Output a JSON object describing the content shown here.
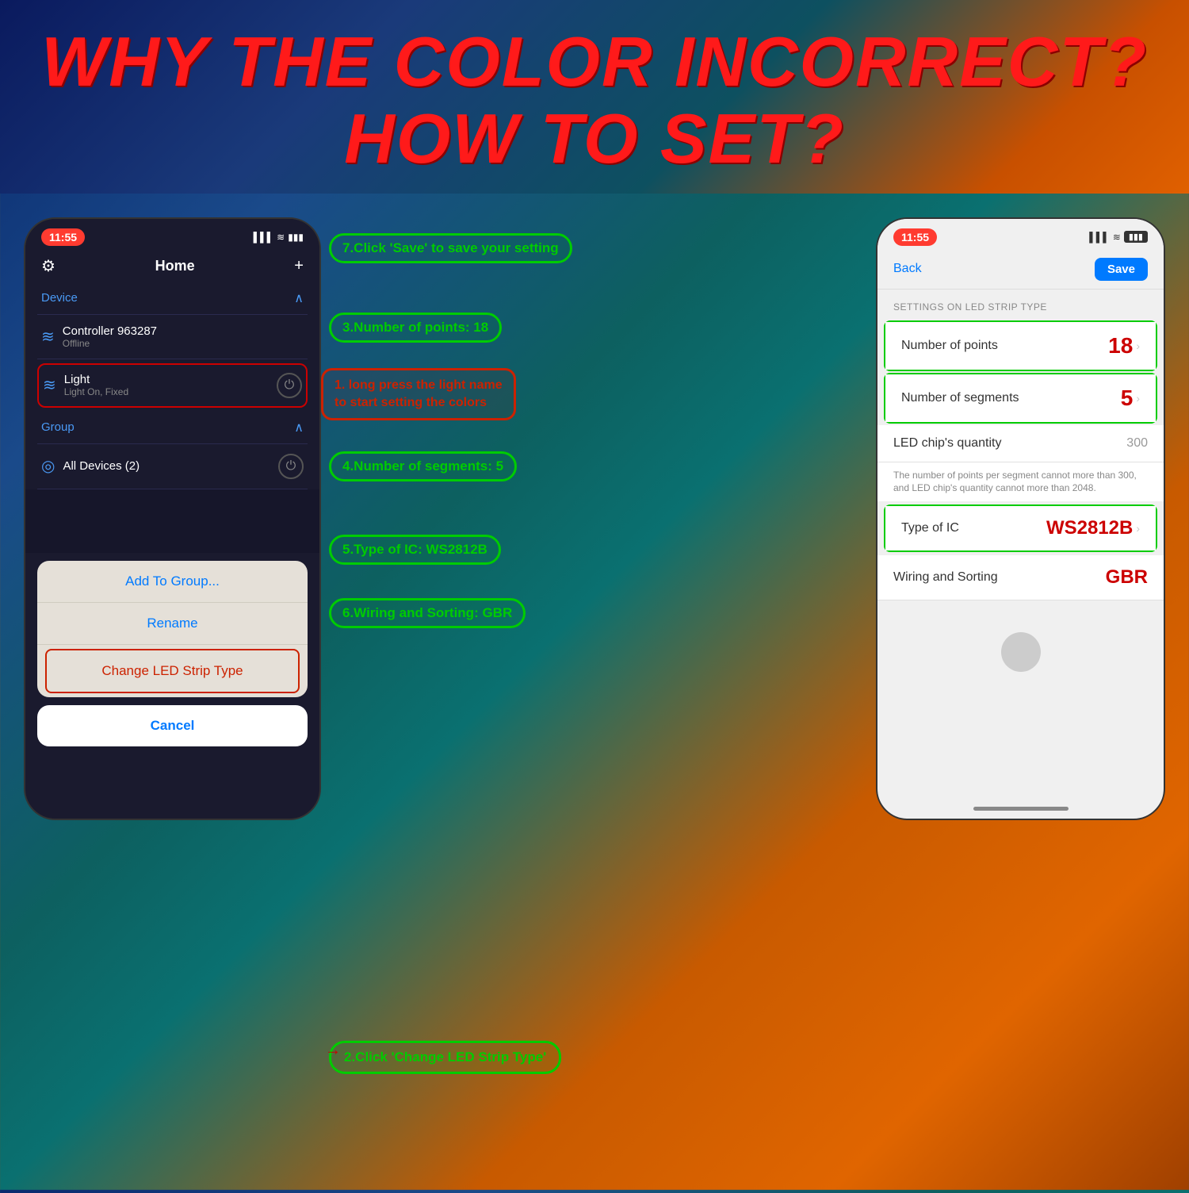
{
  "header": {
    "line1": "WHY THE COLOR INCORRECT?",
    "line2": "HOW TO SET?"
  },
  "left_phone": {
    "time": "11:55",
    "nav_title": "Home",
    "device_section": "Device",
    "controller_name": "Controller  963287",
    "controller_status": "Offline",
    "light_name": "Light",
    "light_status": "Light On, Fixed",
    "group_section": "Group",
    "all_devices": "All Devices (2)",
    "menu": {
      "add_to_group": "Add To Group...",
      "rename": "Rename",
      "change_led": "Change LED Strip Type",
      "cancel": "Cancel"
    }
  },
  "right_phone": {
    "time": "11:55",
    "back_label": "Back",
    "save_label": "Save",
    "section_title": "SETTINGS ON LED STRIP TYPE",
    "rows": [
      {
        "label": "Number of points",
        "value": "18",
        "highlight": true
      },
      {
        "label": "Number of segments",
        "value": "5",
        "highlight": true
      },
      {
        "label": "LED chip's quantity",
        "value": "300",
        "highlight": false
      },
      {
        "label": "Type of IC",
        "value": "WS2812B",
        "highlight": true,
        "value_red": true
      },
      {
        "label": "Wiring and Sorting",
        "value": "GBR",
        "highlight": false,
        "value_red": true
      }
    ],
    "note": "The number of points per segment cannot more than 300, and LED chip's quantity cannot more than 2048."
  },
  "annotations": {
    "step1": "1. long press the light name\nto start setting the colors",
    "step2": "2.Click 'Change LED Strip Type'",
    "step3": "3.Number of points: 18",
    "step4": "4.Number of segments: 5",
    "step5": "5.Type of IC: WS2812B",
    "step6": "6.Wiring and Sorting: GBR",
    "step7": "7.Click 'Save' to save your setting"
  },
  "icons": {
    "gear": "⚙",
    "plus": "+",
    "power": "⏻",
    "bulb": "💡",
    "group": "⊙",
    "wifi": "📶",
    "battery": "🔋",
    "signal": "▌▌▌",
    "chevron_up": "∧",
    "chevron_right": ">",
    "back_arrow": "< Back"
  }
}
